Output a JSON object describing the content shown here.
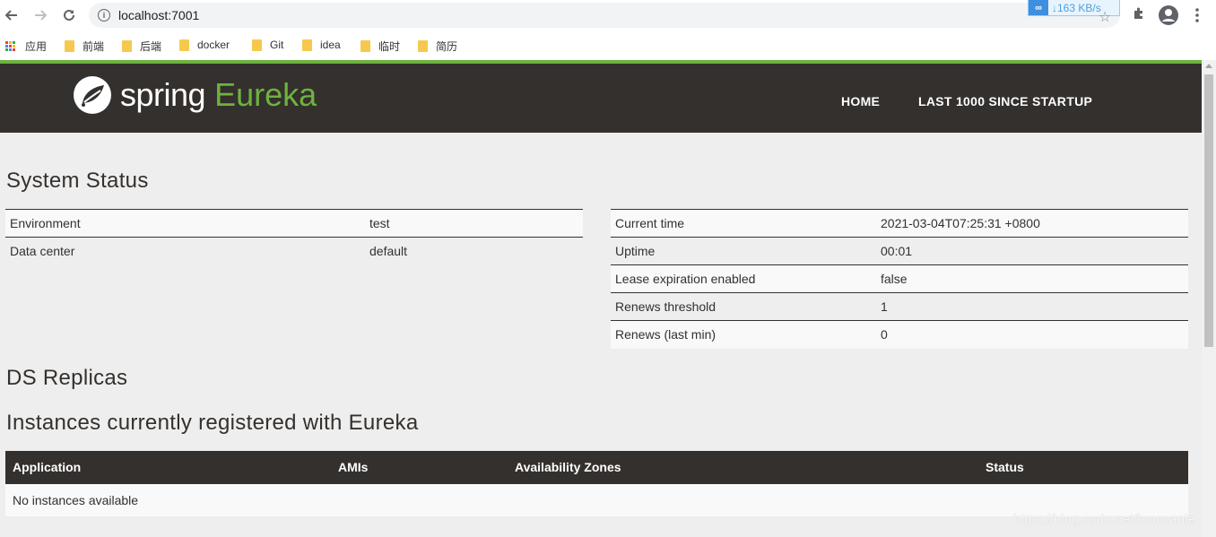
{
  "browser": {
    "url": "localhost:7001",
    "speed": "163 KB/s",
    "bookmarks": [
      {
        "label": "应用",
        "icon": "apps-grid-icon"
      },
      {
        "label": "前端",
        "icon": "folder-icon"
      },
      {
        "label": "后端",
        "icon": "folder-icon"
      },
      {
        "label": "docker",
        "icon": "folder-icon"
      },
      {
        "label": "Git",
        "icon": "folder-icon"
      },
      {
        "label": "idea",
        "icon": "folder-icon"
      },
      {
        "label": "临时",
        "icon": "folder-icon"
      },
      {
        "label": "简历",
        "icon": "folder-icon"
      }
    ]
  },
  "header": {
    "brand_spring": "spring",
    "brand_eureka": "Eureka",
    "nav": [
      "HOME",
      "LAST 1000 SINCE STARTUP"
    ]
  },
  "system_status": {
    "title": "System Status",
    "left": [
      {
        "key": "Environment",
        "value": "test"
      },
      {
        "key": "Data center",
        "value": "default"
      }
    ],
    "right": [
      {
        "key": "Current time",
        "value": "2021-03-04T07:25:31 +0800"
      },
      {
        "key": "Uptime",
        "value": "00:01"
      },
      {
        "key": "Lease expiration enabled",
        "value": "false"
      },
      {
        "key": "Renews threshold",
        "value": "1"
      },
      {
        "key": "Renews (last min)",
        "value": "0"
      }
    ]
  },
  "replicas": {
    "title": "DS Replicas"
  },
  "instances": {
    "title": "Instances currently registered with Eureka",
    "columns": [
      "Application",
      "AMIs",
      "Availability Zones",
      "Status"
    ],
    "empty": "No instances available"
  },
  "watermark": "https://blog.csdn.net/houwanle",
  "colors": {
    "brand_green": "#6db33f",
    "navbar_bg": "#34302d",
    "page_bg": "#eeeeee"
  }
}
